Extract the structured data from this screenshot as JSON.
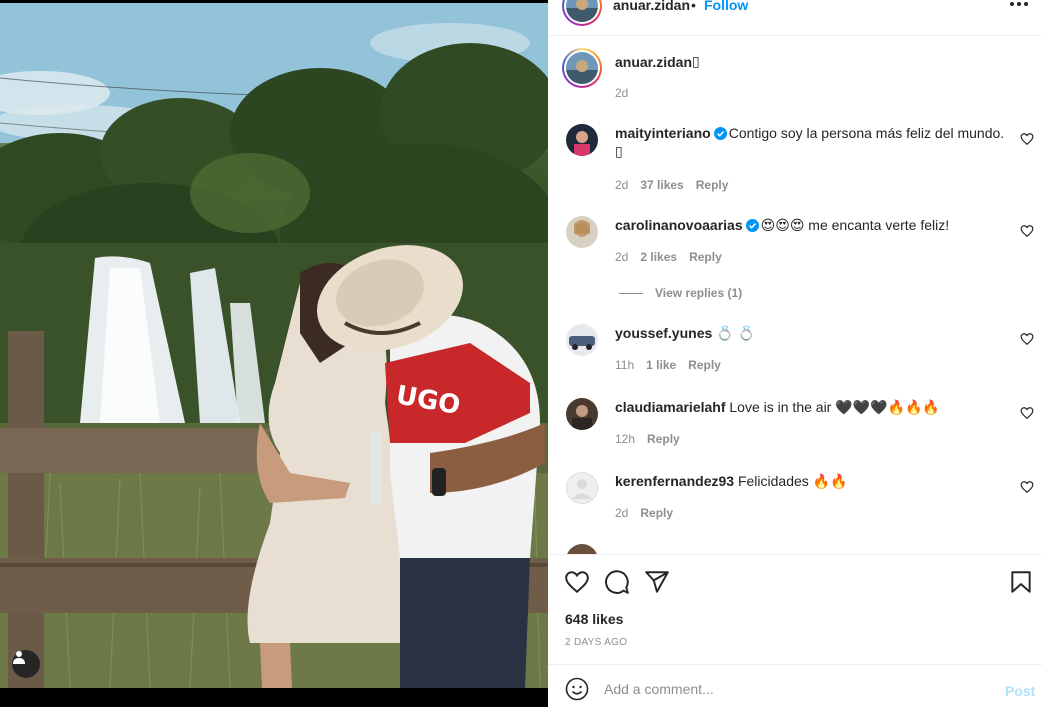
{
  "post": {
    "author": "anuar.zidan",
    "follow_label": "Follow",
    "separator": "•",
    "caption_text": "▯",
    "caption_time": "2d",
    "likes": "648 likes",
    "date": "2 DAYS AGO"
  },
  "comments": [
    {
      "user": "maityinteriano",
      "verified": true,
      "text": "Contigo soy la persona más feliz del mundo. ▯",
      "time": "2d",
      "likes": "37 likes",
      "reply": "Reply"
    },
    {
      "user": "carolinanovoaarias",
      "verified": true,
      "text": "😍😍😍 me encanta verte feliz!",
      "time": "2d",
      "likes": "2 likes",
      "reply": "Reply",
      "view_replies": "View replies (1)"
    },
    {
      "user": "youssef.yunes",
      "verified": false,
      "text": "💍 💍",
      "time": "11h",
      "likes": "1 like",
      "reply": "Reply"
    },
    {
      "user": "claudiamarielahf",
      "verified": false,
      "text": "Love is in the air 🖤🖤🖤🔥🔥🔥",
      "time": "12h",
      "likes": "",
      "reply": "Reply"
    },
    {
      "user": "kerenfernandez93",
      "verified": false,
      "text": "Felicidades 🔥🔥",
      "time": "2d",
      "likes": "",
      "reply": "Reply"
    }
  ],
  "add_comment": {
    "placeholder": "Add a comment...",
    "post_label": "Post"
  },
  "icons": {
    "like": "heart-icon",
    "comment": "comment-icon",
    "share": "share-icon",
    "save": "bookmark-icon",
    "emoji": "emoji-icon",
    "more": "more-icon",
    "verified": "verified-badge-icon",
    "tag": "user-tag-icon"
  },
  "colors": {
    "follow": "#0095f6",
    "verified": "#0095f6",
    "post_disabled": "#b2dffc",
    "muted": "#8e8e8e"
  }
}
